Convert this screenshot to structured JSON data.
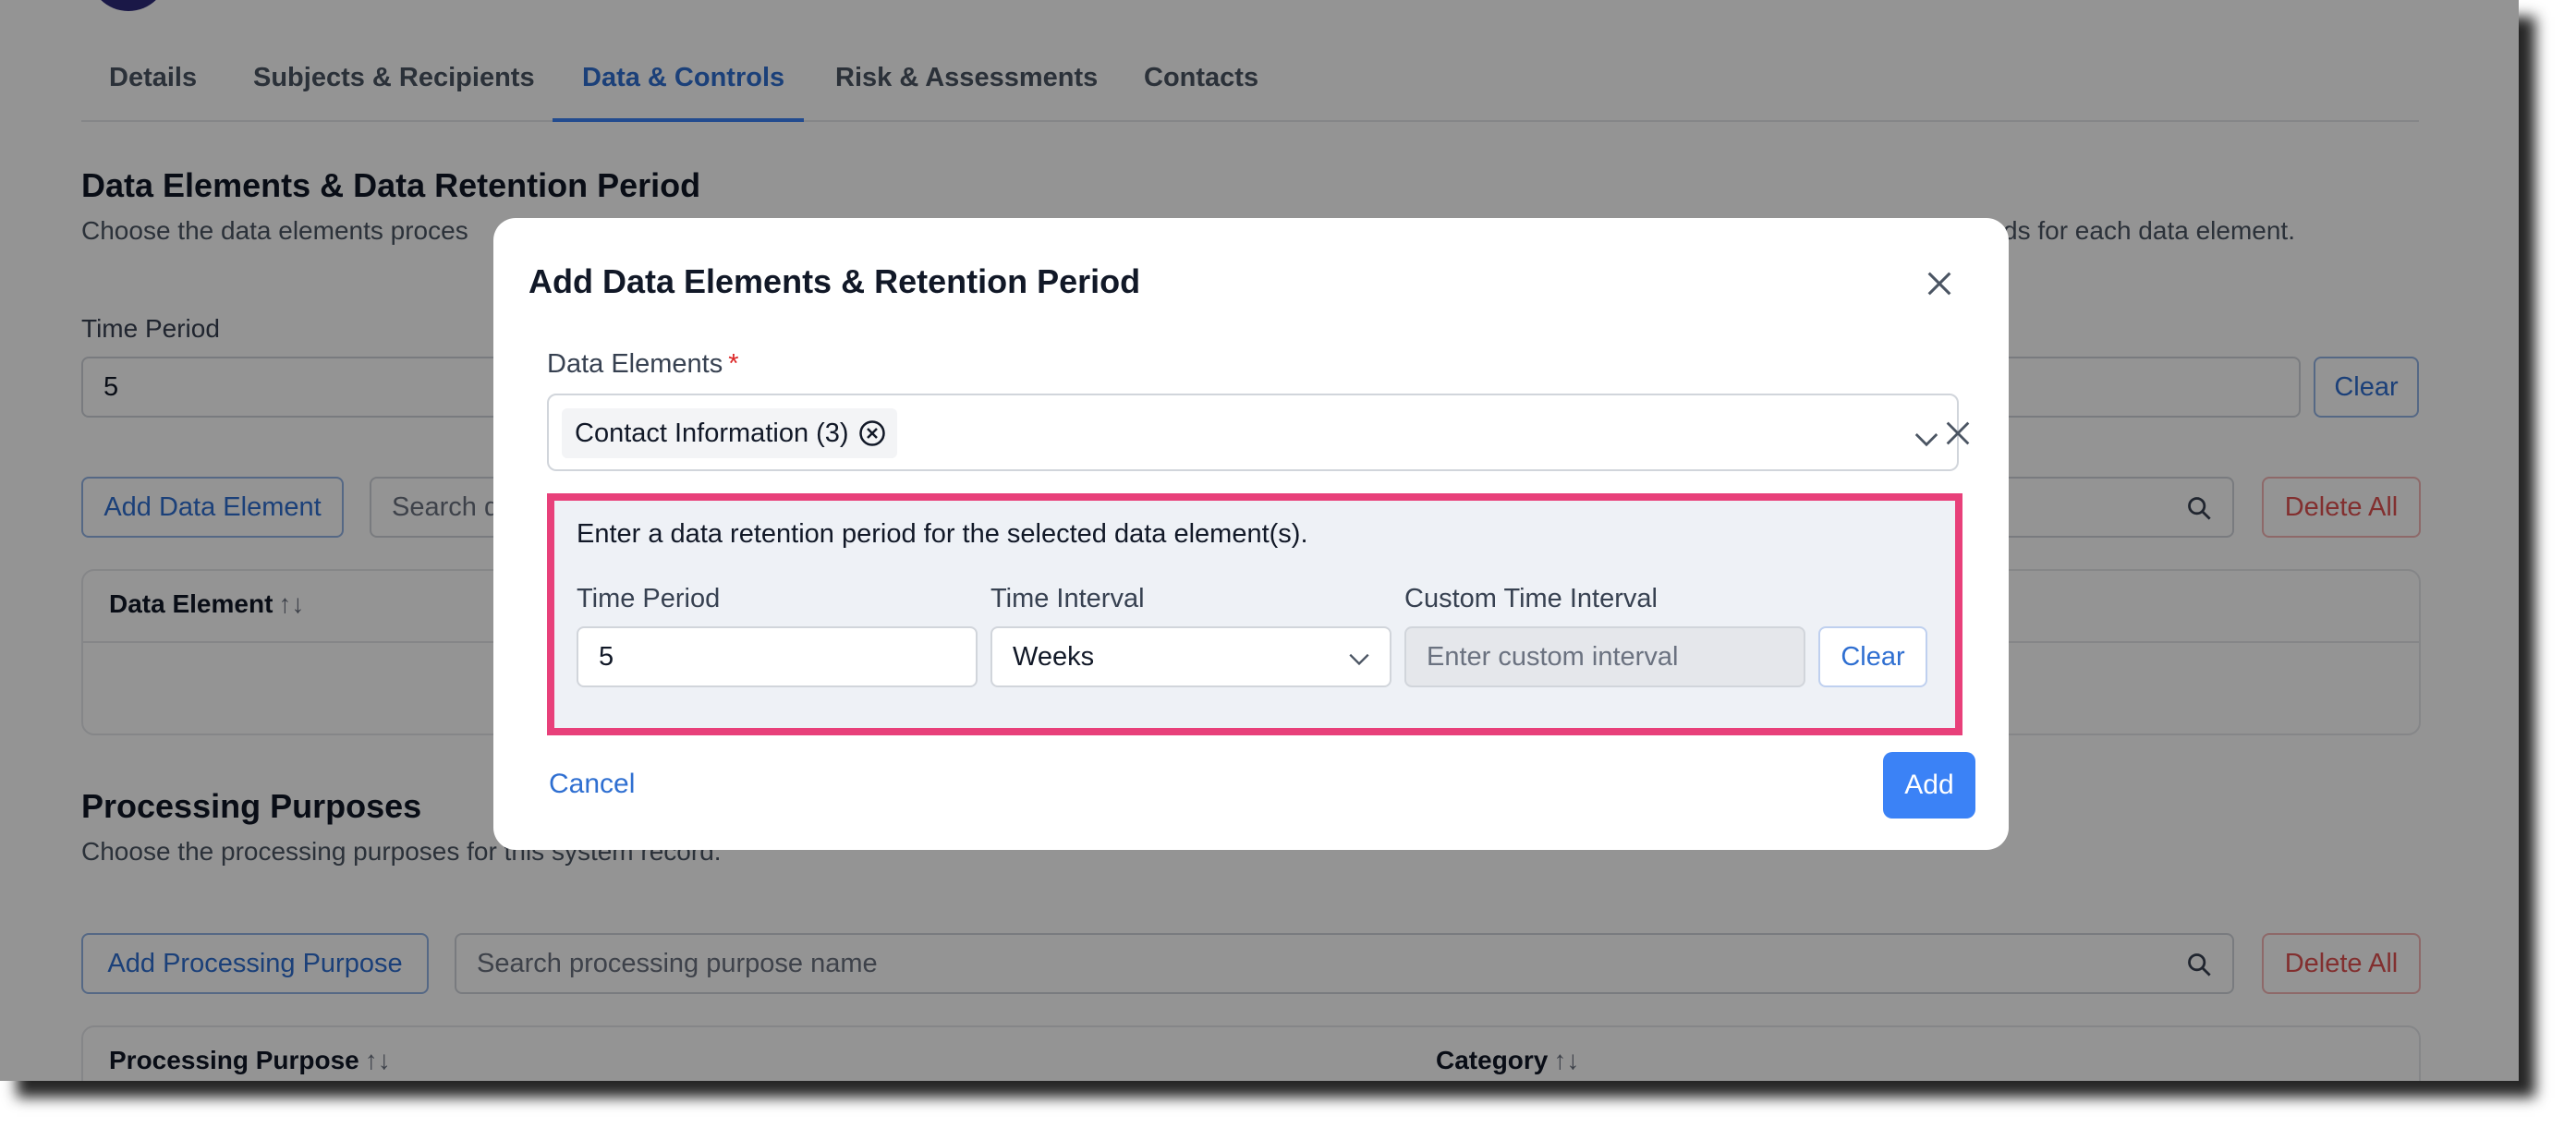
{
  "tabs": [
    {
      "label": "Details"
    },
    {
      "label": "Subjects & Recipients"
    },
    {
      "label": "Data & Controls"
    },
    {
      "label": "Risk & Assessments"
    },
    {
      "label": "Contacts"
    }
  ],
  "data_section": {
    "title": "Data Elements & Data Retention Period",
    "desc_left": "Choose the data elements proces",
    "desc_right": "ds for each data element.",
    "time_period_label": "Time Period",
    "time_period_value": "5",
    "clear_label": "Clear",
    "add_button": "Add Data Element",
    "search_placeholder": "Search d",
    "delete_all": "Delete All",
    "table_header": "Data Element",
    "sort_glyph": "↑↓"
  },
  "processing_section": {
    "title": "Processing Purposes",
    "desc": "Choose the processing purposes for this system record.",
    "add_button": "Add Processing Purpose",
    "search_placeholder": "Search processing purpose name",
    "delete_all": "Delete All",
    "col1": "Processing Purpose",
    "col2": "Category",
    "sort_glyph": "↑↓"
  },
  "modal": {
    "title": "Add Data Elements & Retention Period",
    "data_elements_label": "Data Elements",
    "required_mark": "*",
    "chip_label": "Contact Information (3)",
    "retention_prompt": "Enter a data retention period for the selected data element(s).",
    "time_period_label": "Time Period",
    "time_period_value": "5",
    "time_interval_label": "Time Interval",
    "time_interval_value": "Weeks",
    "custom_interval_label": "Custom Time Interval",
    "custom_interval_placeholder": "Enter custom interval",
    "clear_label": "Clear",
    "cancel_label": "Cancel",
    "add_label": "Add"
  },
  "colors": {
    "accent": "#3b82f6",
    "highlight_border": "#e8407a",
    "danger": "#e05252"
  }
}
